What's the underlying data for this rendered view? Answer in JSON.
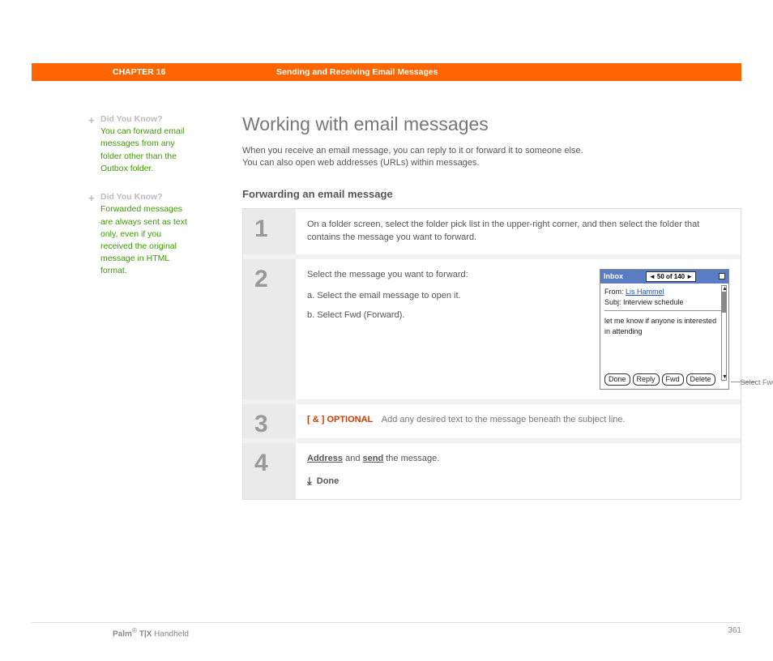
{
  "header": {
    "chapter_label": "CHAPTER 16",
    "chapter_title": "Sending and Receiving Email Messages"
  },
  "sidebar": {
    "dyk_label": "Did You Know?",
    "items": [
      {
        "text": "You can forward email messages from any folder other than the Outbox folder."
      },
      {
        "text": "Forwarded messages are always sent as text only, even if you received the original message in HTML format."
      }
    ]
  },
  "main": {
    "title": "Working with email messages",
    "intro_line1": "When you receive an email message, you can reply to it or forward it to someone else.",
    "intro_line2": "You can also open web addresses (URLs) within messages.",
    "subtitle": "Forwarding an email message"
  },
  "steps": [
    {
      "num": "1",
      "text": "On a folder screen, select the folder pick list in the upper-right corner, and then select the folder that contains the message you want to forward."
    },
    {
      "num": "2",
      "lead": "Select the message you want to forward:",
      "a": "a.  Select the email message to open it.",
      "b": "b.  Select Fwd (Forward)."
    },
    {
      "num": "3",
      "optional_tag": "[ & ]  OPTIONAL",
      "optional_text": "Add any desired text to the message beneath the subject line."
    },
    {
      "num": "4",
      "link1": "Address",
      "mid": " and ",
      "link2": "send",
      "tail": " the message.",
      "done": "Done"
    }
  ],
  "device": {
    "folder": "Inbox",
    "pager_left": "◄",
    "pager_text": "50 of 140",
    "pager_right": "►",
    "from_label": "From: ",
    "from_name": "Lis Hammel",
    "subj_label": "Subj: ",
    "subj_text": "Interview schedule",
    "body1": "let me know if anyone is interested",
    "body2": "in attending",
    "buttons": {
      "done": "Done",
      "reply": "Reply",
      "fwd": "Fwd",
      "delete": "Delete"
    },
    "callout": "Select Fwd"
  },
  "footer": {
    "brand_bold": "Palm",
    "reg": "®",
    "model": " T|X",
    "tail": " Handheld",
    "page": "361"
  }
}
